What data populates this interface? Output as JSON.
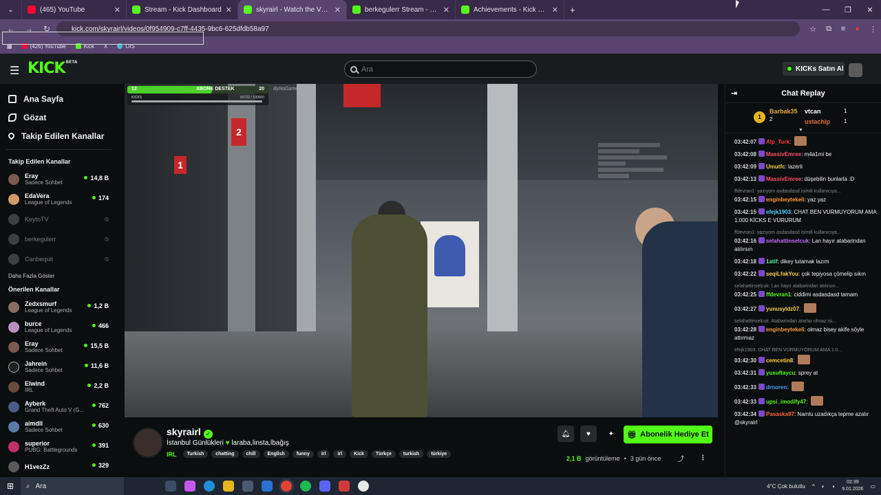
{
  "browser": {
    "tabs": [
      {
        "title": "(465) YouTube",
        "favicon": "youtube-icon"
      },
      {
        "title": "Stream - Kick Dashboard",
        "favicon": "kick-icon"
      },
      {
        "title": "skyrairl - Watch the VOD on",
        "favicon": "kick-icon",
        "active": true
      },
      {
        "title": "berkegulerr Stream - Watch Liv",
        "favicon": "kick-icon"
      },
      {
        "title": "Achievements - Kick Dashboard",
        "favicon": "kick-icon"
      }
    ],
    "new_tab": "+",
    "url": "kick.com/skyrairl/videos/0f954909-c7ff-4435-9bc6-625dfdb58a97",
    "bookmarks": [
      "(426) YouTube",
      "Kick",
      "X",
      "OIS"
    ]
  },
  "header": {
    "logo": "KICK",
    "logo_badge": "BETA",
    "search_placeholder": "Ara",
    "kicks_button": "KICKs Satın Al"
  },
  "sidebar": {
    "nav": [
      {
        "label": "Ana Sayfa",
        "icon": "home-icon"
      },
      {
        "label": "Gözat",
        "icon": "compass-icon"
      },
      {
        "label": "Takip Edilen Kanallar",
        "icon": "heart-icon"
      }
    ],
    "followed_title": "Takip Edilen Kanallar",
    "followed": [
      {
        "name": "Eray",
        "category": "Sadece Sohbet",
        "viewers": "14,8 B",
        "online": true
      },
      {
        "name": "EdaVera",
        "category": "League of Legends",
        "viewers": "174",
        "online": true
      },
      {
        "name": "KeytoTV",
        "category": "",
        "viewers": "",
        "online": false
      },
      {
        "name": "berkegulerr",
        "category": "",
        "viewers": "",
        "online": false
      },
      {
        "name": "Canbequit",
        "category": "",
        "viewers": "",
        "online": false
      }
    ],
    "show_more": "Daha Fazla Göster",
    "recommended_title": "Önerilen Kanallar",
    "recommended": [
      {
        "name": "Zedxsmurf",
        "category": "League of Legends",
        "viewers": "1,2 B"
      },
      {
        "name": "burce",
        "category": "League of Legends",
        "viewers": "466"
      },
      {
        "name": "Eray",
        "category": "Sadece Sohbet",
        "viewers": "15,5 B"
      },
      {
        "name": "Jahrein",
        "category": "Sadece Sohbet",
        "viewers": "11,6 B"
      },
      {
        "name": "Elwind",
        "category": "IRL",
        "viewers": "2,2 B"
      },
      {
        "name": "Ayberk",
        "category": "Grand Theft Auto V (G...",
        "viewers": "762"
      },
      {
        "name": "aimdll",
        "category": "Sadece Sohbet",
        "viewers": "630"
      },
      {
        "name": "superior",
        "category": "PUBG: Battlegrounds",
        "viewers": "391"
      },
      {
        "name": "H1vezZz",
        "category": "",
        "viewers": "329"
      }
    ]
  },
  "player_overlay": {
    "goal_left": "12",
    "goal_label": "ABONE DESTEK",
    "goal_right": "20",
    "goal_progress": 0.6,
    "kicks_label": "KICKS",
    "kicks_value": "60722 / 100000",
    "watermark": "ByNoGame"
  },
  "video_info": {
    "channel": "skyrairl",
    "title": "İstanbul Günlükleri",
    "title_after": "laraba,linsta,lbağış",
    "category": "IRL",
    "tags": [
      "Turkish",
      "chatting",
      "chill",
      "English",
      "funny",
      "irl",
      "irl",
      "Kick",
      "Türkçe",
      "turkish",
      "türkiye"
    ],
    "subscribe_button": "Abonelik Hediye Et",
    "views": "2,1 B",
    "views_label": "görüntüleme",
    "age": "3 gün önce"
  },
  "chat": {
    "title": "Chat Replay",
    "leaders": [
      {
        "name": "Barbak35",
        "count": "2"
      },
      {
        "name": "vtcan",
        "count": "1"
      },
      {
        "name": "ustachip",
        "count": "1"
      }
    ],
    "messages": [
      {
        "time": "03:42:07",
        "user": "Alp_Turk",
        "color": "#ff3b3b",
        "text": "",
        "emote": true,
        "reply": ""
      },
      {
        "time": "03:42:08",
        "user": "MassivEmree",
        "color": "#ff4f6e",
        "text": "m4a1mi be",
        "emote": false,
        "reply": ""
      },
      {
        "time": "03:42:09",
        "user": "Umutfc",
        "color": "#f5d14a",
        "text": "lazerli",
        "emote": false,
        "reply": ""
      },
      {
        "time": "03:42:13",
        "user": "MassivEmree",
        "color": "#ff4f6e",
        "text": "düşebilin bunlarla :D",
        "emote": false,
        "reply": ""
      },
      {
        "time": "03:42:15",
        "user": "enginbeytekeli",
        "color": "#ff9b3b",
        "text": "yaz yaz",
        "emote": false,
        "reply": "ffdevran1: yazıyom asdasdasd isimili kullanıcıya..."
      },
      {
        "time": "03:42:15",
        "user": "efejk1903",
        "color": "#4fd1ff",
        "text": "CHAT BEN VURMUYORUM AMA 1.000 KİCKS E VURURUM",
        "emote": false,
        "reply": ""
      },
      {
        "time": "03:42:16",
        "user": "selahattinselcuk",
        "color": "#c86bff",
        "text": "Lan hayır atabarindan atılırsın",
        "emote": false,
        "reply": "ffdevran1: yazıyom asdasdasd isimili kullanıcıya..."
      },
      {
        "time": "03:42:18",
        "user": "1atif",
        "color": "#5cf0a0",
        "text": "dikey tutamak lazım",
        "emote": false,
        "reply": ""
      },
      {
        "time": "03:42:22",
        "user": "seqiLfakYou",
        "color": "#f5d14a",
        "text": "çok tepiyosa çömelip sıkın",
        "emote": false,
        "reply": ""
      },
      {
        "time": "03:42:25",
        "user": "ffdevran1",
        "color": "#53fc18",
        "text": "ciddimi asdasdasd tamam",
        "emote": false,
        "reply": "selahattinselcuk: Lan hayır atabarindan atılırsın..."
      },
      {
        "time": "03:42:27",
        "user": "yunusyldz07",
        "color": "#f5d14a",
        "text": "",
        "emote": true,
        "reply": ""
      },
      {
        "time": "03:42:28",
        "user": "enginbeytekeli",
        "color": "#ff9b3b",
        "text": "olmaz bisey akife söyle attırmaz",
        "emote": false,
        "reply": "selahattinselcuk: Atabarindan atarlar olmaz isi..."
      },
      {
        "time": "03:42:30",
        "user": "cemcetin8",
        "color": "#ffd23a",
        "text": "",
        "emote": true,
        "reply": "efejk1903: CHAT BEN VURMUYORUM AMA 1.0..."
      },
      {
        "time": "03:42:31",
        "user": "yusuftaycu",
        "color": "#53fc18",
        "text": "sprey at",
        "emote": false,
        "reply": ""
      },
      {
        "time": "03:42:33",
        "user": "drnoren",
        "color": "#4f9bff",
        "text": "",
        "emote": true,
        "reply": ""
      },
      {
        "time": "03:42:33",
        "user": "upsi_imodify47",
        "color": "#53fc18",
        "text": "",
        "emote": true,
        "reply": ""
      },
      {
        "time": "03:42:34",
        "user": "Pasaska97",
        "color": "#ff6a3b",
        "text": "Namlu uzadıkça tepme azalır @skyrairl",
        "emote": false,
        "reply": ""
      }
    ]
  },
  "taskbar": {
    "search_placeholder": "Ara",
    "weather": "4°C  Çok bulutlu",
    "time": "02:39",
    "date": "9.01.2026"
  }
}
